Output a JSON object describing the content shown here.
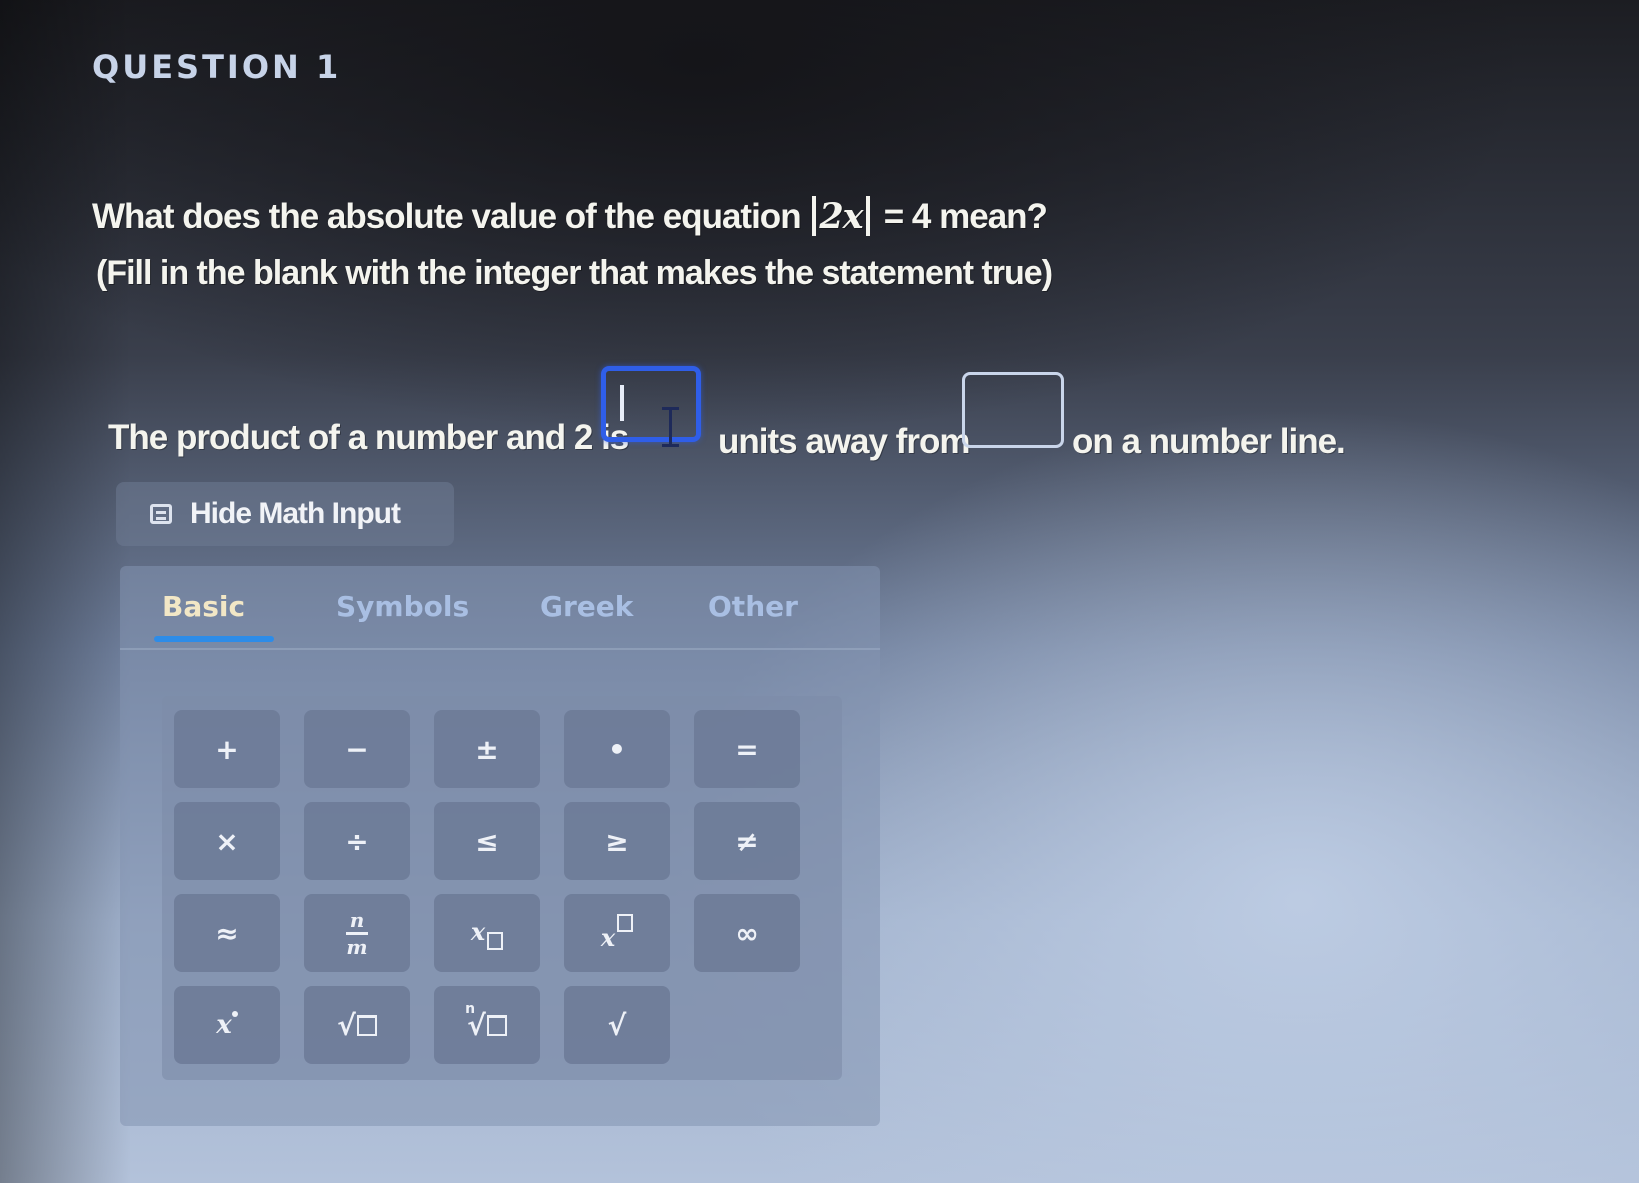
{
  "question": {
    "label": "QUESTION 1",
    "prompt_before": "What does the absolute value of the equation",
    "equation_inner": "2x",
    "equation_rest": "= 4",
    "prompt_after": "mean?",
    "instruction": "(Fill in the blank with the integer that makes the statement true)"
  },
  "statement": {
    "part1": "The product of a number and 2 is",
    "part2": "units away from",
    "part3": "on a number line.",
    "blank1_value": "",
    "blank2_value": ""
  },
  "math_input": {
    "toggle_label": "Hide Math Input",
    "tabs": [
      {
        "label": "Basic",
        "active": true
      },
      {
        "label": "Symbols",
        "active": false
      },
      {
        "label": "Greek",
        "active": false
      },
      {
        "label": "Other",
        "active": false
      }
    ],
    "keys": {
      "plus": "+",
      "minus": "−",
      "plus_minus": "±",
      "dot": "•",
      "equals": "=",
      "times": "×",
      "divide": "÷",
      "less_equal": "≤",
      "greater_equal": "≥",
      "not_equal": "≠",
      "approx": "≈",
      "fraction_num": "n",
      "fraction_den": "m",
      "subscript_base": "x",
      "superscript_base": "x",
      "infinity": "∞",
      "x_power": "x",
      "nth_root_index": "n",
      "sqrt_symbol": "√",
      "root_symbol": "√"
    }
  },
  "colors": {
    "focus_blue": "#2f5ee8",
    "tab_underline": "#2d8ce8"
  }
}
